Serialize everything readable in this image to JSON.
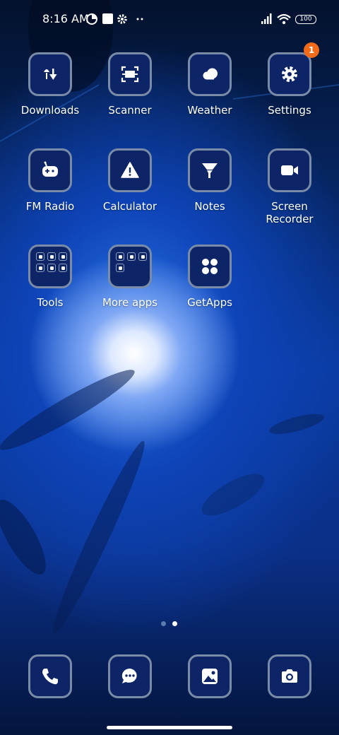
{
  "status_bar": {
    "time": "8:16 AM",
    "icons": [
      "data-saver-icon",
      "square-notification-icon",
      "gear-icon",
      "more-dots-icon",
      "signal-icon",
      "wifi-icon"
    ],
    "battery": "100"
  },
  "apps": [
    {
      "label": "Downloads",
      "icon": "downloads-icon"
    },
    {
      "label": "Scanner",
      "icon": "scanner-icon"
    },
    {
      "label": "Weather",
      "icon": "weather-icon"
    },
    {
      "label": "Settings",
      "icon": "gear-icon",
      "badge": "1"
    },
    {
      "label": "FM Radio",
      "icon": "radio-icon"
    },
    {
      "label": "Calculator",
      "icon": "warning-icon"
    },
    {
      "label": "Notes",
      "icon": "funnel-icon"
    },
    {
      "label": "Screen Recorder",
      "icon": "video-camera-icon"
    },
    {
      "label": "Tools",
      "icon": "folder-icon"
    },
    {
      "label": "More apps",
      "icon": "folder-icon"
    },
    {
      "label": "GetApps",
      "icon": "getapps-icon"
    }
  ],
  "dock": [
    {
      "icon": "phone-icon"
    },
    {
      "icon": "messages-icon"
    },
    {
      "icon": "gallery-icon"
    },
    {
      "icon": "camera-icon"
    }
  ],
  "page_indicator": {
    "total": 2,
    "active": 2
  },
  "colors": {
    "badge": "#f06a1a",
    "tile": "#0d2466",
    "tile_border": "#7a8ba8"
  }
}
